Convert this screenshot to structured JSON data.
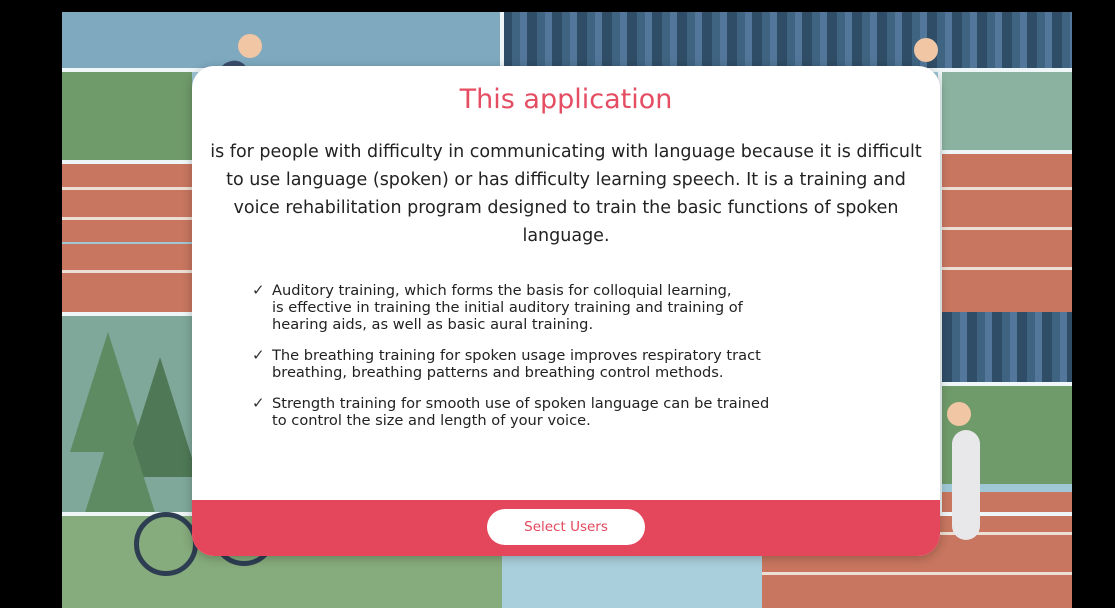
{
  "dialog": {
    "title": "This application",
    "intro": "is for people with difficulty in communicating with language because it is difficult to use language (spoken) or has difficulty learning speech. It is a training and voice rehabilitation program designed to train the basic functions of spoken language.",
    "features": [
      {
        "icon": "✓",
        "lines": [
          "Auditory training, which forms the basis for colloquial learning,",
          "is effective in training the initial auditory training and training of",
          "hearing aids, as well as basic aural training."
        ]
      },
      {
        "icon": "✓",
        "lines": [
          "The breathing training for spoken usage improves respiratory tract",
          "breathing, breathing patterns and breathing control methods."
        ]
      },
      {
        "icon": "✓",
        "lines": [
          "Strength training for smooth use of spoken language can be trained",
          "to control the size and length of your voice."
        ]
      }
    ],
    "button_label": "Select Users"
  },
  "colors": {
    "accent": "#e4475c",
    "title": "#e44d62",
    "letterbox": "#000000"
  }
}
